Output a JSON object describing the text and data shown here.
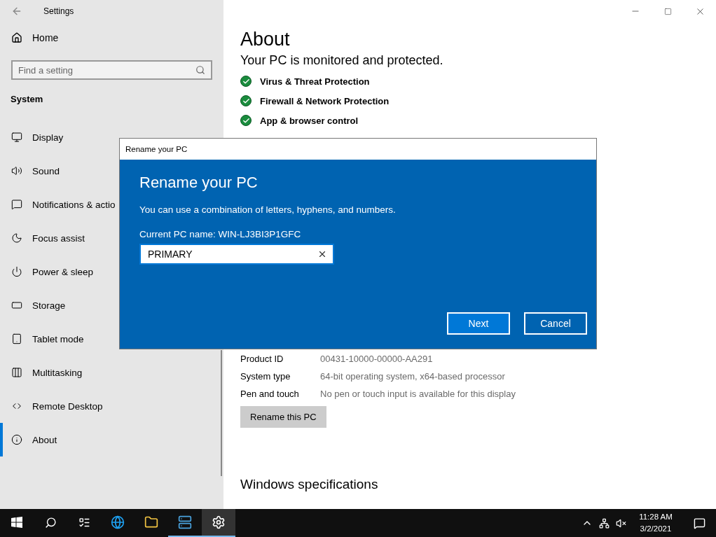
{
  "window": {
    "title": "Settings"
  },
  "sidebar": {
    "home": "Home",
    "search": {
      "placeholder": "Find a setting"
    },
    "section": "System",
    "items": [
      {
        "label": "Display",
        "selected": false
      },
      {
        "label": "Sound",
        "selected": false
      },
      {
        "label": "Notifications & actio",
        "selected": false
      },
      {
        "label": "Focus assist",
        "selected": false
      },
      {
        "label": "Power & sleep",
        "selected": false
      },
      {
        "label": "Storage",
        "selected": false
      },
      {
        "label": "Tablet mode",
        "selected": false
      },
      {
        "label": "Multitasking",
        "selected": false
      },
      {
        "label": "Remote Desktop",
        "selected": false
      },
      {
        "label": "About",
        "selected": true
      }
    ]
  },
  "main": {
    "title": "About",
    "protection_heading": "Your PC is monitored and protected.",
    "protection": [
      {
        "label": "Virus & Threat Protection",
        "ok": true
      },
      {
        "label": "Firewall & Network Protection",
        "ok": true
      },
      {
        "label": "App & browser control",
        "ok": true
      }
    ],
    "specs": [
      {
        "name": "Product ID",
        "value": "00431-10000-00000-AA291"
      },
      {
        "name": "System type",
        "value": "64-bit operating system, x64-based processor"
      },
      {
        "name": "Pen and touch",
        "value": "No pen or touch input is available for this display"
      }
    ],
    "rename_button": "Rename this PC",
    "windows_heading": "Windows specifications"
  },
  "dialog": {
    "title": "Rename your PC",
    "heading": "Rename your PC",
    "description": "You can use a combination of letters, hyphens, and numbers.",
    "current_name": "Current PC name: WIN-LJ3BI3P1GFC",
    "value": "PRIMARY",
    "buttons": [
      {
        "label": "Next",
        "primary": true
      },
      {
        "label": "Cancel",
        "primary": false
      }
    ]
  },
  "taskbar": {
    "apps": [
      {
        "running": false,
        "active": false
      },
      {
        "running": false,
        "active": false
      },
      {
        "running": true,
        "active": false
      },
      {
        "running": true,
        "active": true
      }
    ],
    "time": "11:28 AM",
    "date": "3/2/2021"
  }
}
